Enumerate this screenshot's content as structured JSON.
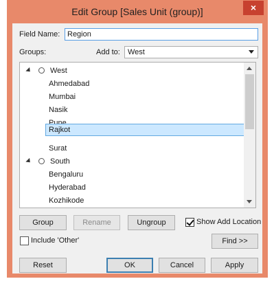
{
  "window": {
    "title": "Edit Group [Sales Unit (group)]",
    "close_glyph": "×"
  },
  "field_name": {
    "label": "Field Name:",
    "value": "Region"
  },
  "groups_label": "Groups:",
  "add_to": {
    "label": "Add to:",
    "value": "West"
  },
  "tree": {
    "items": [
      {
        "type": "group",
        "label": "West"
      },
      {
        "type": "member",
        "label": "Ahmedabad"
      },
      {
        "type": "member",
        "label": "Mumbai"
      },
      {
        "type": "member",
        "label": "Nasik"
      },
      {
        "type": "member",
        "label": "Pune"
      },
      {
        "type": "member",
        "label": "Rajkot",
        "selected": true
      },
      {
        "type": "member",
        "label": "Surat"
      },
      {
        "type": "group",
        "label": "South"
      },
      {
        "type": "member",
        "label": "Bengaluru"
      },
      {
        "type": "member",
        "label": "Hyderabad"
      },
      {
        "type": "member",
        "label": "Kozhikode"
      }
    ]
  },
  "buttons": {
    "group": "Group",
    "rename": "Rename",
    "ungroup": "Ungroup",
    "find": "Find >>",
    "reset": "Reset",
    "ok": "OK",
    "cancel": "Cancel",
    "apply": "Apply"
  },
  "show_add_location": {
    "label": "Show Add Location",
    "checked": true
  },
  "include_other": {
    "label": "Include 'Other'",
    "checked": false
  },
  "colors": {
    "title_bar": "#e8896a",
    "selection": "#cce8ff",
    "focus_border": "#569de5"
  }
}
